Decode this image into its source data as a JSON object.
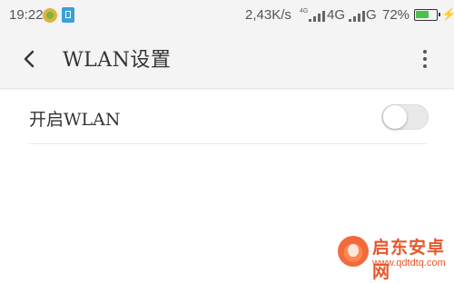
{
  "status_bar": {
    "time": "19:22",
    "net_speed": "2,43K/s",
    "tiny_indicator": "4G",
    "network_1": "4G",
    "network_2": "G",
    "battery": "72%",
    "battery_level": 0.72,
    "battery_color": "#49c34a"
  },
  "app_bar": {
    "back_icon": "chevron-left-icon",
    "title": "WLAN设置",
    "more_icon": "more-vertical-icon"
  },
  "settings": {
    "wlan_toggle_label": "开启WLAN",
    "wlan_enabled": false
  },
  "watermark": {
    "name": "启东安卓网",
    "url": "www.qdtdtq.com"
  }
}
